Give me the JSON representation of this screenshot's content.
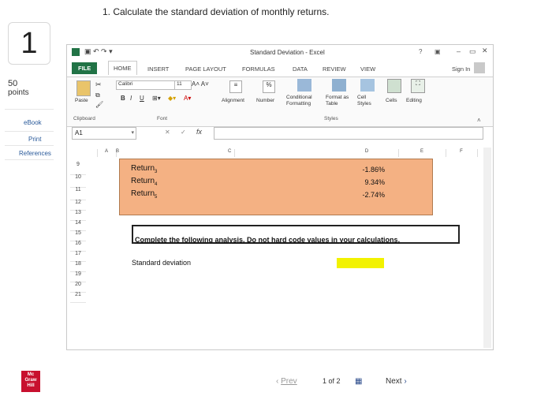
{
  "question": {
    "number": "1",
    "text": "1. Calculate the standard deviation of monthly returns."
  },
  "left_panel": {
    "points_value": "50",
    "points_label": "points",
    "ebook": "eBook",
    "print": "Print",
    "references": "References",
    "logo_text": [
      "Mc",
      "Graw",
      "Hill"
    ]
  },
  "excel": {
    "title": "Standard Deviation - Excel",
    "sign_in": "Sign In",
    "tabs": [
      "FILE",
      "HOME",
      "INSERT",
      "PAGE LAYOUT",
      "FORMULAS",
      "DATA",
      "REVIEW",
      "VIEW"
    ],
    "ribbon": {
      "paste": "Paste",
      "clipboard": "Clipboard",
      "font_name": "Calibri",
      "font_size": "11",
      "font_group": "Font",
      "bold": "B",
      "italic": "I",
      "underline": "U",
      "alignment": "Alignment",
      "number": "Number",
      "percent": "%",
      "conditional_formatting": "Conditional Formatting",
      "format_as_table": "Format as Table",
      "cell_styles": "Cell Styles",
      "styles_group": "Styles",
      "cells": "Cells",
      "editing": "Editing"
    },
    "name_box": "A1",
    "fx": "fx",
    "columns": [
      "A",
      "B",
      "C",
      "D",
      "E",
      "F"
    ],
    "rows": [
      "9",
      "10",
      "11",
      "12",
      "13",
      "14",
      "15",
      "16",
      "17",
      "18",
      "19",
      "20",
      "21"
    ],
    "labels": [
      "Return",
      "Return",
      "Return"
    ],
    "subscripts": [
      "3",
      "4",
      "5"
    ],
    "values": [
      "-1.86%",
      "9.34%",
      "-2.74%"
    ],
    "instruction": "Complete the following analysis. Do not hard code values in your calculations.",
    "std_label": "Standard deviation"
  },
  "pager": {
    "prev": "Prev",
    "position": "1 of 2",
    "next": "Next"
  }
}
